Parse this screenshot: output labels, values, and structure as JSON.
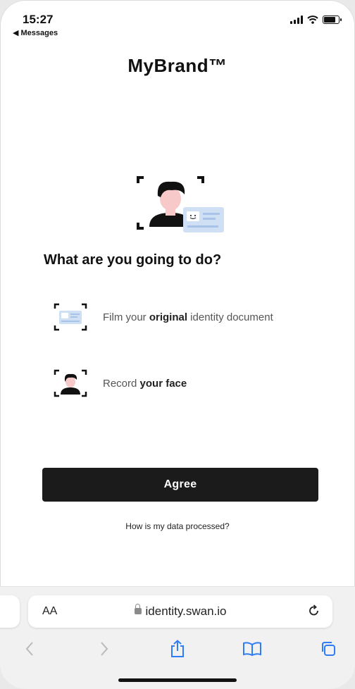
{
  "status_bar": {
    "time": "15:27",
    "back_label": "◀ Messages",
    "battery_level": 0.8
  },
  "brand": {
    "name": "MyBrand™"
  },
  "main": {
    "heading": "What are you going to do?",
    "steps": [
      {
        "icon": "id-document-icon",
        "prefix": "Film your ",
        "bold": "original",
        "suffix": " identity document"
      },
      {
        "icon": "face-record-icon",
        "prefix": "Record ",
        "bold": "your face",
        "suffix": ""
      }
    ],
    "agree_label": "Agree",
    "data_link": "How is my data processed?"
  },
  "safari": {
    "text_size_label": "AA",
    "url": "identity.swan.io",
    "icons": [
      "back-icon",
      "forward-icon",
      "share-icon",
      "bookmarks-icon",
      "tabs-icon",
      "reload-icon",
      "lock-icon"
    ]
  },
  "colors": {
    "button_bg": "#1b1b1b",
    "accent_blue": "#3b82f6",
    "skin": "#f7c9c9",
    "card_blue": "#cfe0f5"
  }
}
